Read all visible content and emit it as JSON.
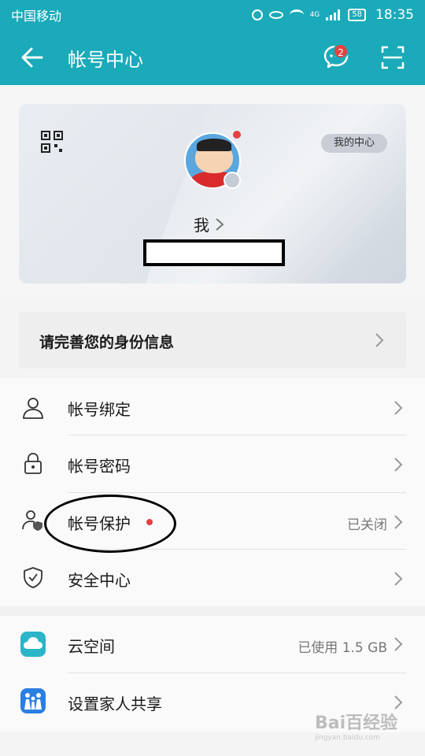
{
  "status_bar": {
    "carrier": "中国移动",
    "network": "4G",
    "battery": "58",
    "time": "18:35"
  },
  "app_bar": {
    "title": "帐号中心",
    "message_badge": "2"
  },
  "profile": {
    "my_center_label": "我的中心",
    "name": "我"
  },
  "banner": {
    "label": "请完善您的身份信息"
  },
  "account_items": [
    {
      "icon": "person-icon",
      "label": "帐号绑定",
      "value": ""
    },
    {
      "icon": "lock-icon",
      "label": "帐号密码",
      "value": ""
    },
    {
      "icon": "person-shield-icon",
      "label": "帐号保护",
      "value": "已关闭"
    },
    {
      "icon": "shield-check-icon",
      "label": "安全中心",
      "value": ""
    }
  ],
  "service_items": [
    {
      "icon": "cloud-icon",
      "label": "云空间",
      "value": "已使用 1.5 GB"
    },
    {
      "icon": "family-share-icon",
      "label": "设置家人共享",
      "value": ""
    }
  ],
  "watermark": {
    "main": "Bai百经验",
    "sub": "jingyan.baidu.com"
  },
  "colors": {
    "primary": "#1aaab9",
    "badge": "#e64040",
    "cloud": "#2bb5c9",
    "family": "#2a7fe0"
  }
}
